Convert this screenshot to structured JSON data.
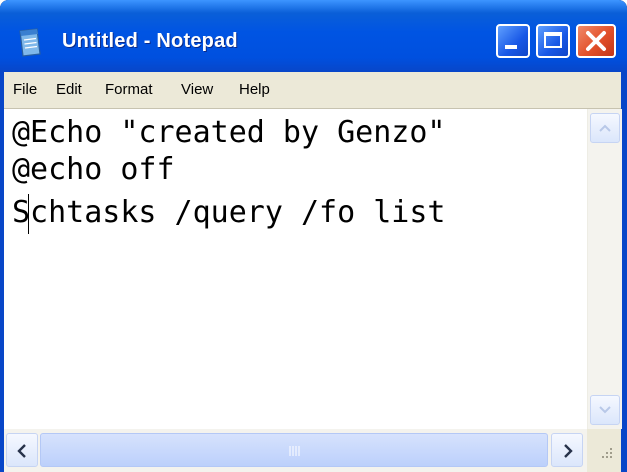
{
  "window": {
    "title": "Untitled - Notepad",
    "icon": "notepad-icon",
    "controls": [
      "minimize-icon",
      "maximize-icon",
      "close-icon"
    ]
  },
  "menu": {
    "file": "File",
    "edit": "Edit",
    "format": "Format",
    "view": "View",
    "help": "Help"
  },
  "editor": {
    "lines": [
      "@Echo \"created by Genzo\"",
      "@echo off",
      "Schtasks /query /fo list"
    ]
  },
  "colors": {
    "titlebar": "#0054e3",
    "menubar": "#ece9d8",
    "close_button": "#e2502a"
  }
}
